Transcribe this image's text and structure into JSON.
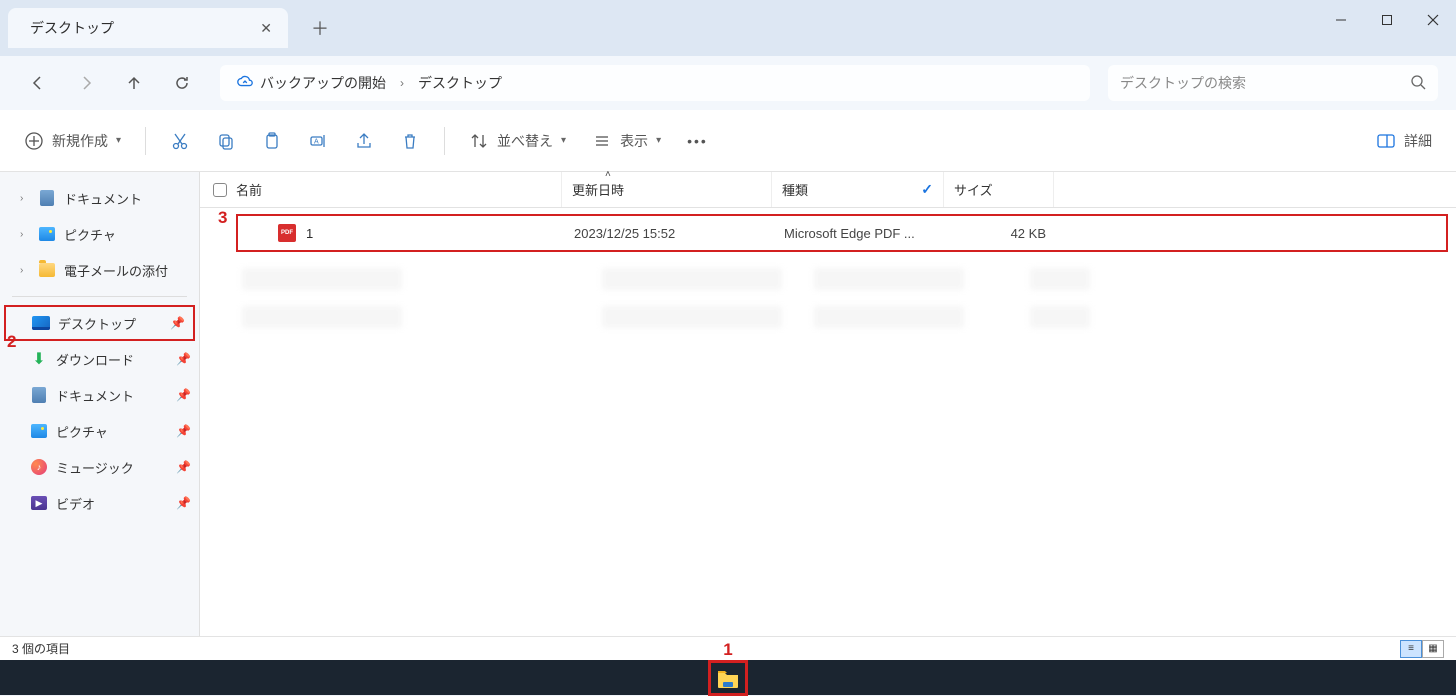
{
  "titlebar": {
    "tab_title": "デスクトップ"
  },
  "breadcrumb": {
    "backup_label": "バックアップの開始",
    "current": "デスクトップ"
  },
  "search": {
    "placeholder": "デスクトップの検索"
  },
  "toolbar": {
    "new_label": "新規作成",
    "sort_label": "並べ替え",
    "view_label": "表示",
    "details_label": "詳細"
  },
  "sidebar": {
    "top": [
      {
        "label": "ドキュメント"
      },
      {
        "label": "ピクチャ"
      },
      {
        "label": "電子メールの添付"
      }
    ],
    "pinned": [
      {
        "label": "デスクトップ"
      },
      {
        "label": "ダウンロード"
      },
      {
        "label": "ドキュメント"
      },
      {
        "label": "ピクチャ"
      },
      {
        "label": "ミュージック"
      },
      {
        "label": "ビデオ"
      }
    ]
  },
  "columns": {
    "name": "名前",
    "date": "更新日時",
    "type": "種類",
    "size": "サイズ"
  },
  "files": [
    {
      "name": "1",
      "date": "2023/12/25 15:52",
      "type": "Microsoft Edge PDF ...",
      "size": "42 KB"
    }
  ],
  "statusbar": {
    "item_count": "3 個の項目"
  },
  "annotations": {
    "n1": "1",
    "n2": "2",
    "n3": "3"
  }
}
